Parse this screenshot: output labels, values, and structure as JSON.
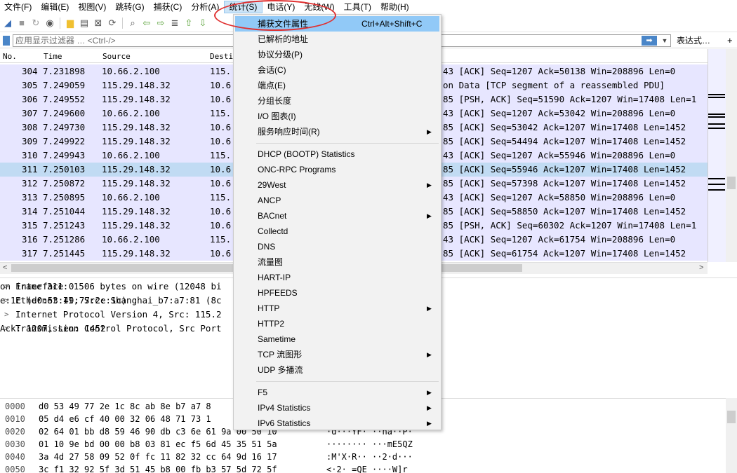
{
  "menubar": [
    "文件(F)",
    "编辑(E)",
    "视图(V)",
    "跳转(G)",
    "捕获(C)",
    "分析(A)",
    "统计(S)",
    "电话(Y)",
    "无线(W)",
    "工具(T)",
    "帮助(H)"
  ],
  "filter": {
    "placeholder": "应用显示过滤器 … <Ctrl-/>",
    "expression": "表达式…",
    "plus": "+"
  },
  "columns": [
    "No.",
    "Time",
    "Source",
    "Destination"
  ],
  "packets": [
    {
      "no": "304",
      "time": "7.231898",
      "src": "10.66.2.100",
      "dst": "115.",
      "info": "43 [ACK] Seq=1207 Ack=50138 Win=208896 Len=0"
    },
    {
      "no": "305",
      "time": "7.249059",
      "src": "115.29.148.32",
      "dst": "10.6",
      "info": "on Data [TCP segment of a reassembled PDU]"
    },
    {
      "no": "306",
      "time": "7.249552",
      "src": "115.29.148.32",
      "dst": "10.6",
      "info": "85 [PSH, ACK] Seq=51590 Ack=1207 Win=17408 Len=1"
    },
    {
      "no": "307",
      "time": "7.249600",
      "src": "10.66.2.100",
      "dst": "115.",
      "info": "43 [ACK] Seq=1207 Ack=53042 Win=208896 Len=0"
    },
    {
      "no": "308",
      "time": "7.249730",
      "src": "115.29.148.32",
      "dst": "10.6",
      "info": "85 [ACK] Seq=53042 Ack=1207 Win=17408 Len=1452"
    },
    {
      "no": "309",
      "time": "7.249922",
      "src": "115.29.148.32",
      "dst": "10.6",
      "info": "85 [ACK] Seq=54494 Ack=1207 Win=17408 Len=1452"
    },
    {
      "no": "310",
      "time": "7.249943",
      "src": "10.66.2.100",
      "dst": "115.",
      "info": "43 [ACK] Seq=1207 Ack=55946 Win=208896 Len=0"
    },
    {
      "no": "311",
      "time": "7.250103",
      "src": "115.29.148.32",
      "dst": "10.6",
      "info": "85 [ACK] Seq=55946 Ack=1207 Win=17408 Len=1452"
    },
    {
      "no": "312",
      "time": "7.250872",
      "src": "115.29.148.32",
      "dst": "10.6",
      "info": "85 [ACK] Seq=57398 Ack=1207 Win=17408 Len=1452"
    },
    {
      "no": "313",
      "time": "7.250895",
      "src": "10.66.2.100",
      "dst": "115.",
      "info": "43 [ACK] Seq=1207 Ack=58850 Win=208896 Len=0"
    },
    {
      "no": "314",
      "time": "7.251044",
      "src": "115.29.148.32",
      "dst": "10.6",
      "info": "85 [ACK] Seq=58850 Ack=1207 Win=17408 Len=1452"
    },
    {
      "no": "315",
      "time": "7.251243",
      "src": "115.29.148.32",
      "dst": "10.6",
      "info": "85 [PSH, ACK] Seq=60302 Ack=1207 Win=17408 Len=1"
    },
    {
      "no": "316",
      "time": "7.251286",
      "src": "10.66.2.100",
      "dst": "115.",
      "info": "43 [ACK] Seq=1207 Ack=61754 Win=208896 Len=0"
    },
    {
      "no": "317",
      "time": "7.251445",
      "src": "115.29.148.32",
      "dst": "10.6",
      "info": "85 [ACK] Seq=61754 Ack=1207 Win=17408 Len=1452"
    }
  ],
  "details": [
    {
      "left": "Frame 311: 1506 bytes on wire (12048 bi",
      "right": "on interface 0"
    },
    {
      "left": "Ethernet II, Src: Shanghai_b7:a7:81 (8c",
      "right": "e:1c (d0:53:49:77:2e:1c)"
    },
    {
      "left": "Internet Protocol Version 4, Src: 115.2",
      "right": ""
    },
    {
      "left": "Transmission Control Protocol, Src Port",
      "right": "Ack: 1207, Len: 1452"
    }
  ],
  "bytes": [
    {
      "off": "0000",
      "hex": "d0 53 49 77 2e 1c 8c ab  8e b7 a7 8",
      "asc": ""
    },
    {
      "off": "0010",
      "hex": "05 d4 e6 cf 40 00 32 06  48 71 73 1",
      "asc": ""
    },
    {
      "off": "0020",
      "hex": "02 64 01 bb d8 59 46 90  db c3 6e 61 9a 00 50 10",
      "asc": "·d···YF·  ··na··P·"
    },
    {
      "off": "0030",
      "hex": "01 10 9e bd 00 00 b8 03  81 ec f5 6d 45 35 51 5a",
      "asc": "········  ···mE5QZ"
    },
    {
      "off": "0040",
      "hex": "3a 4d 27 58 09 52 0f fc  11 82 32 cc 64 9d 16 17",
      "asc": ":M'X·R··  ··2·d···"
    },
    {
      "off": "0050",
      "hex": "3c f1 32 92 5f 3d 51 45  b8 00 fb b3 57 5d 72 5f",
      "asc": "<·2·_=QE  ····W]r_"
    }
  ],
  "stats_menu": [
    {
      "type": "item",
      "label": "捕获文件属性",
      "shortcut": "Ctrl+Alt+Shift+C",
      "highlight": true
    },
    {
      "type": "item",
      "label": "已解析的地址"
    },
    {
      "type": "item",
      "label": "协议分级(P)"
    },
    {
      "type": "item",
      "label": "会话(C)"
    },
    {
      "type": "item",
      "label": "端点(E)"
    },
    {
      "type": "item",
      "label": "分组长度"
    },
    {
      "type": "item",
      "label": "I/O 图表(I)"
    },
    {
      "type": "item",
      "label": "服务响应时间(R)",
      "submenu": true
    },
    {
      "type": "sep"
    },
    {
      "type": "item",
      "label": "DHCP (BOOTP) Statistics"
    },
    {
      "type": "item",
      "label": "ONC-RPC Programs"
    },
    {
      "type": "item",
      "label": "29West",
      "submenu": true
    },
    {
      "type": "item",
      "label": "ANCP"
    },
    {
      "type": "item",
      "label": "BACnet",
      "submenu": true
    },
    {
      "type": "item",
      "label": "Collectd"
    },
    {
      "type": "item",
      "label": "DNS"
    },
    {
      "type": "item",
      "label": "流量图"
    },
    {
      "type": "item",
      "label": "HART-IP"
    },
    {
      "type": "item",
      "label": "HPFEEDS"
    },
    {
      "type": "item",
      "label": "HTTP",
      "submenu": true
    },
    {
      "type": "item",
      "label": "HTTP2"
    },
    {
      "type": "item",
      "label": "Sametime"
    },
    {
      "type": "item",
      "label": "TCP 流图形",
      "submenu": true
    },
    {
      "type": "item",
      "label": "UDP 多播流"
    },
    {
      "type": "sep"
    },
    {
      "type": "item",
      "label": "F5",
      "submenu": true
    },
    {
      "type": "item",
      "label": "IPv4 Statistics",
      "submenu": true
    },
    {
      "type": "item",
      "label": "IPv6 Statistics",
      "submenu": true
    }
  ],
  "colors": {
    "row_bg": "#e7e6ff",
    "row_selected": "#c1dbf3",
    "menu_highlight": "#91c9f7",
    "annotation": "#e03030"
  }
}
